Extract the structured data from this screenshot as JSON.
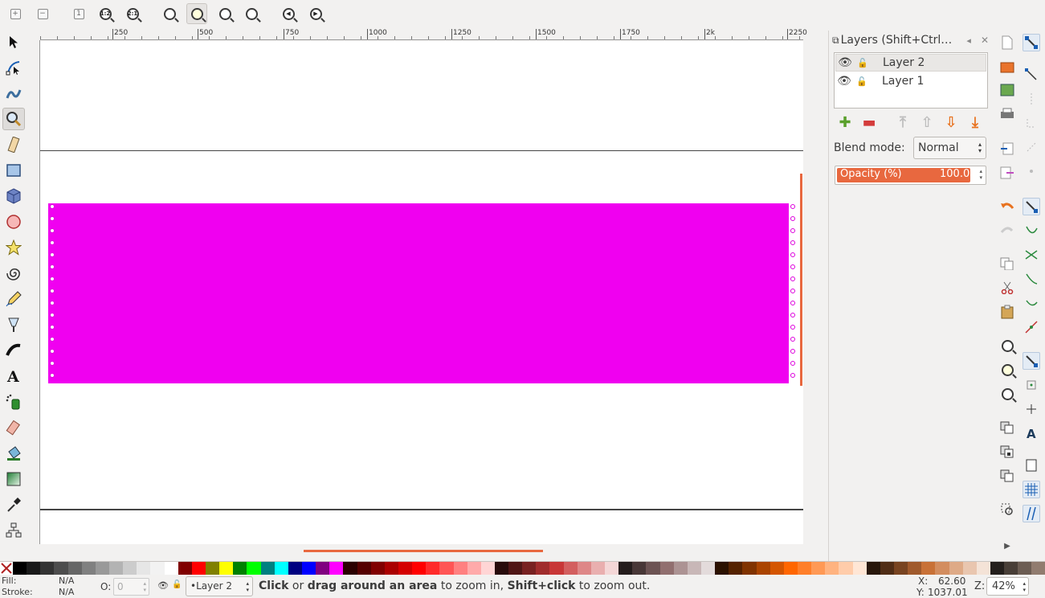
{
  "toolbar": {
    "zoom_1_1": "1:1",
    "zoom_1_2": "1:2",
    "zoom_2_1": "2:1"
  },
  "ruler": {
    "labels": [
      "250",
      "500",
      "750",
      "1000",
      "1250",
      "1500",
      "1750",
      "2k",
      "2250"
    ]
  },
  "layers_panel": {
    "title": "Layers (Shift+Ctrl…",
    "layers": [
      {
        "name": "Layer 2",
        "selected": true
      },
      {
        "name": "Layer 1",
        "selected": false
      }
    ],
    "blend_label": "Blend mode:",
    "blend_value": "Normal",
    "opacity_label": "Opacity (%)",
    "opacity_value": "100.0"
  },
  "canvas": {
    "fill_color": "#f000f0"
  },
  "status": {
    "fill_label": "Fill:",
    "fill_value": "N/A",
    "stroke_label": "Stroke:",
    "stroke_value": "N/A",
    "opacity_label": "O:",
    "opacity_value": "0",
    "layer_value": "•Layer 2",
    "msg_b1": "Click",
    "msg_t1": " or ",
    "msg_b2": "drag around an area",
    "msg_t2": " to zoom in, ",
    "msg_b3": "Shift+click",
    "msg_t3": " to zoom out.",
    "x_label": "X:",
    "x_value": "62.60",
    "y_label": "Y:",
    "y_value": "1037.01",
    "z_label": "Z:",
    "z_value": "42%"
  },
  "palette": [
    "#000000",
    "#1a1a1a",
    "#333333",
    "#4d4d4d",
    "#666666",
    "#808080",
    "#999999",
    "#b3b3b3",
    "#cccccc",
    "#e6e6e6",
    "#f2f2f2",
    "#ffffff",
    "#800000",
    "#ff0000",
    "#808000",
    "#ffff00",
    "#008000",
    "#00ff00",
    "#008080",
    "#00ffff",
    "#000080",
    "#0000ff",
    "#800080",
    "#ff00ff",
    "#2b0000",
    "#550000",
    "#800000",
    "#aa0000",
    "#d40000",
    "#ff0000",
    "#ff2a2a",
    "#ff5555",
    "#ff8080",
    "#ffaaaa",
    "#ffd5d5",
    "#280b0b",
    "#501616",
    "#782121",
    "#a02c2c",
    "#c83737",
    "#d35f5f",
    "#de8787",
    "#e9afaf",
    "#f4d7d7",
    "#241c1c",
    "#483737",
    "#6c5353",
    "#916f6f",
    "#ac9393",
    "#c8b7b7",
    "#e3dbdb",
    "#2b1100",
    "#552200",
    "#803300",
    "#aa4400",
    "#d45500",
    "#ff6600",
    "#ff7f2a",
    "#ff9955",
    "#ffb380",
    "#ffccaa",
    "#ffe6d5",
    "#28170b",
    "#502d16",
    "#784421",
    "#a05a2c",
    "#c87137",
    "#d38d5f",
    "#deaa87",
    "#e9c6af",
    "#f4e3d7",
    "#241f1c",
    "#483e37",
    "#6c5d53",
    "#917c6f"
  ]
}
